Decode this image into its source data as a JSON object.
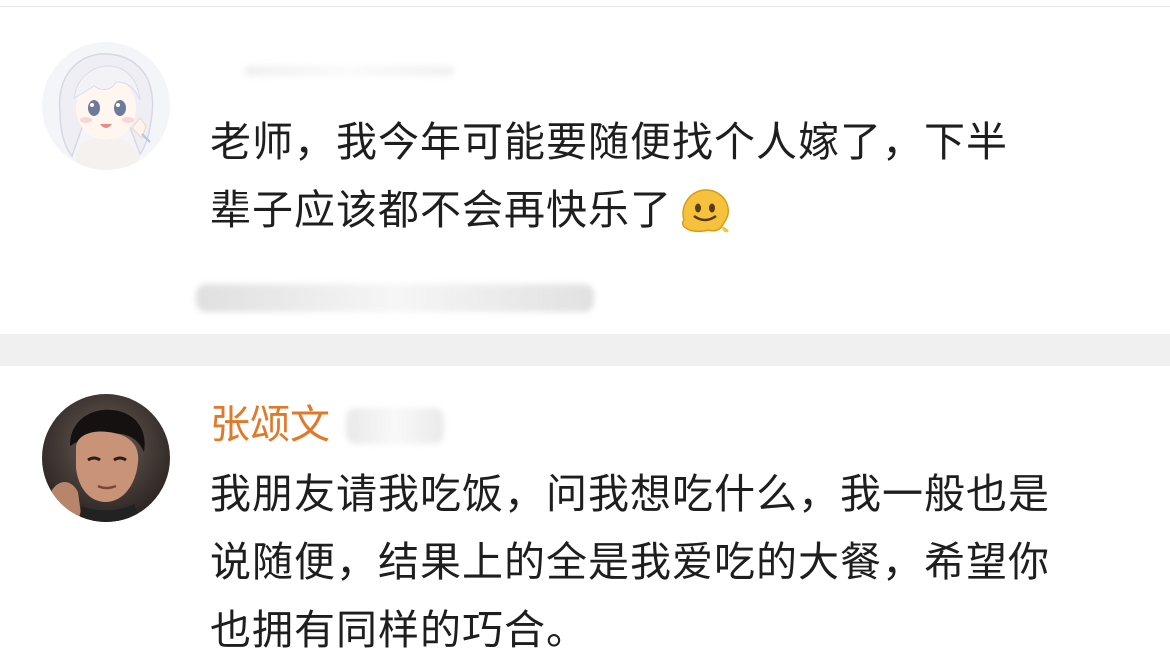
{
  "comments": [
    {
      "username": "",
      "avatar_icon": "anime-girl-avatar-icon",
      "text_lines": [
        "老师，我今年可能要随便找个人嫁了，下半",
        "辈子应该都不会再快乐了"
      ],
      "trailing_emoji": "melting-face-emoji-icon"
    },
    {
      "username": "张颂文",
      "username_color": "#e07a2a",
      "avatar_icon": "man-portrait-avatar-icon",
      "text_lines": [
        "我朋友请我吃饭，问我想吃什么，我一般也是",
        "说随便，结果上的全是我爱吃的大餐，希望你",
        "也拥有同样的巧合。"
      ]
    }
  ]
}
